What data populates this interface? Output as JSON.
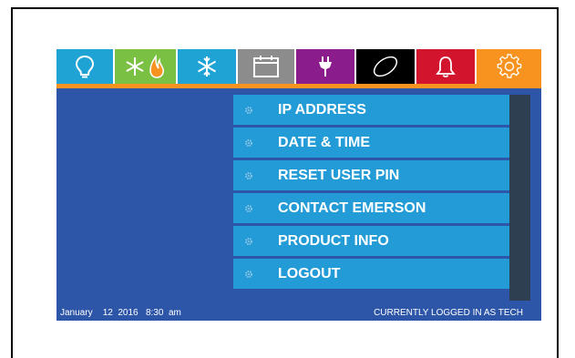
{
  "tabs": [
    {
      "id": "lighting",
      "icon": "lightbulb-icon",
      "bg": "#1fa3d4"
    },
    {
      "id": "hvac",
      "icon": "snowflake-flame-icon",
      "bg": "#7ac143"
    },
    {
      "id": "refrigeration",
      "icon": "snowflake-icon",
      "bg": "#1fa3d4"
    },
    {
      "id": "schedule",
      "icon": "calendar-icon",
      "bg": "#8c8c8c"
    },
    {
      "id": "power",
      "icon": "plug-icon",
      "bg": "#8a1d8b"
    },
    {
      "id": "custom",
      "icon": "ellipse-icon",
      "bg": "#000000"
    },
    {
      "id": "alarms",
      "icon": "bell-icon",
      "bg": "#d2142d"
    },
    {
      "id": "settings",
      "icon": "gear-icon",
      "bg": "#f7931e"
    }
  ],
  "menu": {
    "items": [
      {
        "label": "IP ADDRESS"
      },
      {
        "label": "DATE & TIME"
      },
      {
        "label": "RESET USER PIN"
      },
      {
        "label": "CONTACT EMERSON"
      },
      {
        "label": "PRODUCT INFO"
      },
      {
        "label": "LOGOUT"
      }
    ]
  },
  "status": {
    "date": "January    12  2016   8:30  am",
    "logged_in": "CURRENTLY LOGGED IN AS TECH"
  },
  "colors": {
    "screen_bg": "#2e56a8",
    "menu_item_bg": "#229bd6",
    "accent_orange": "#f7931e",
    "scroll_panel": "#2d3f50"
  }
}
